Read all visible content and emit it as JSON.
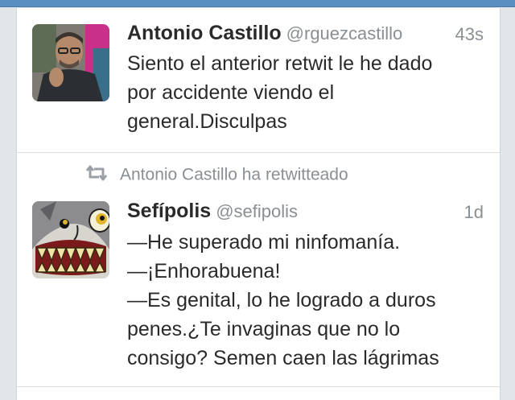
{
  "tweets": [
    {
      "author": "Antonio Castillo",
      "handle": "@rguezcastillo",
      "time": "43s",
      "lines": [
        "Siento el anterior retwit le he dado",
        "por accidente viendo el",
        "general.Disculpas"
      ]
    },
    {
      "retweeted_by": "Antonio Castillo ha retwitteado",
      "author": "Sefípolis",
      "handle": "@sefipolis",
      "time": "1d",
      "lines": [
        "—He superado mi ninfomanía.",
        "—¡Enhorabuena!",
        "—Es genital, lo he logrado a duros",
        "penes.¿Te invaginas que no lo",
        "consigo? Semen caen las lágrimas"
      ]
    }
  ],
  "icons": {
    "retweet": "retweet-icon"
  },
  "colors": {
    "accent": "#5a8fc2",
    "text": "#2a2a2a",
    "muted": "#8a8f94"
  }
}
